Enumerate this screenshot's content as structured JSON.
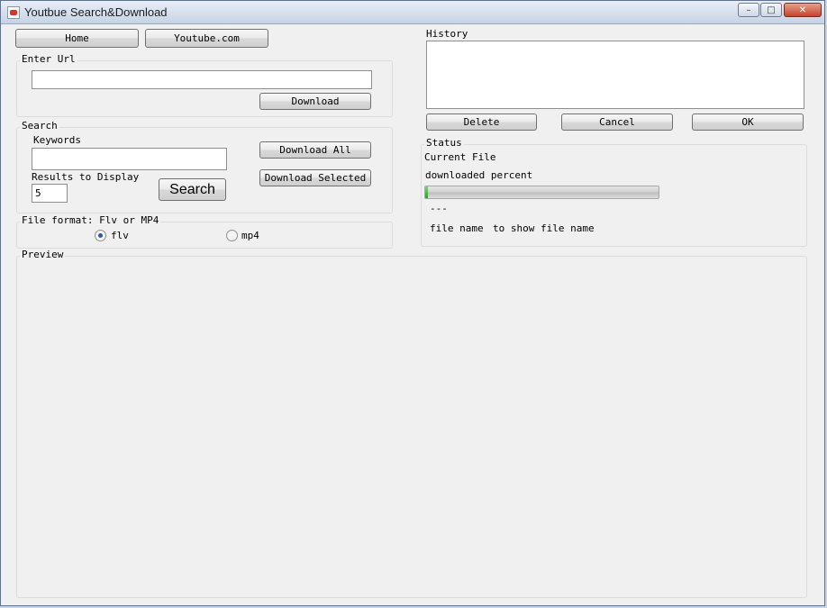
{
  "window": {
    "title": "Youtbue Search&Download",
    "min_icon": "minimize-icon",
    "max_icon": "maximize-icon",
    "close_icon": "close-icon"
  },
  "toolbar": {
    "home_label": "Home",
    "youtube_label": "Youtube.com"
  },
  "enter_url": {
    "label": "Enter Url",
    "value": "",
    "download_label": "Download"
  },
  "search": {
    "label": "Search",
    "keywords_label": "Keywords",
    "keywords_value": "",
    "results_label": "Results to Display",
    "results_value": "5",
    "search_label": "Search",
    "download_all_label": "Download All",
    "download_selected_label": "Download Selected"
  },
  "file_format": {
    "label": "File format: Flv or MP4",
    "options": [
      {
        "label": "flv",
        "checked": true
      },
      {
        "label": "mp4",
        "checked": false
      }
    ]
  },
  "preview": {
    "label": "Preview"
  },
  "history": {
    "label": "History",
    "delete_label": "Delete",
    "cancel_label": "Cancel",
    "ok_label": "OK"
  },
  "status": {
    "label": "Status",
    "current_file": "Current File",
    "downloaded_percent": "downloaded percent",
    "progress": 0.01,
    "progress_text": "---",
    "file_name_label": "file name",
    "file_name_value": "to show file name"
  },
  "colors": {
    "progress_fill": "#2aa12a",
    "title_gradient": "#c6d3e4"
  }
}
